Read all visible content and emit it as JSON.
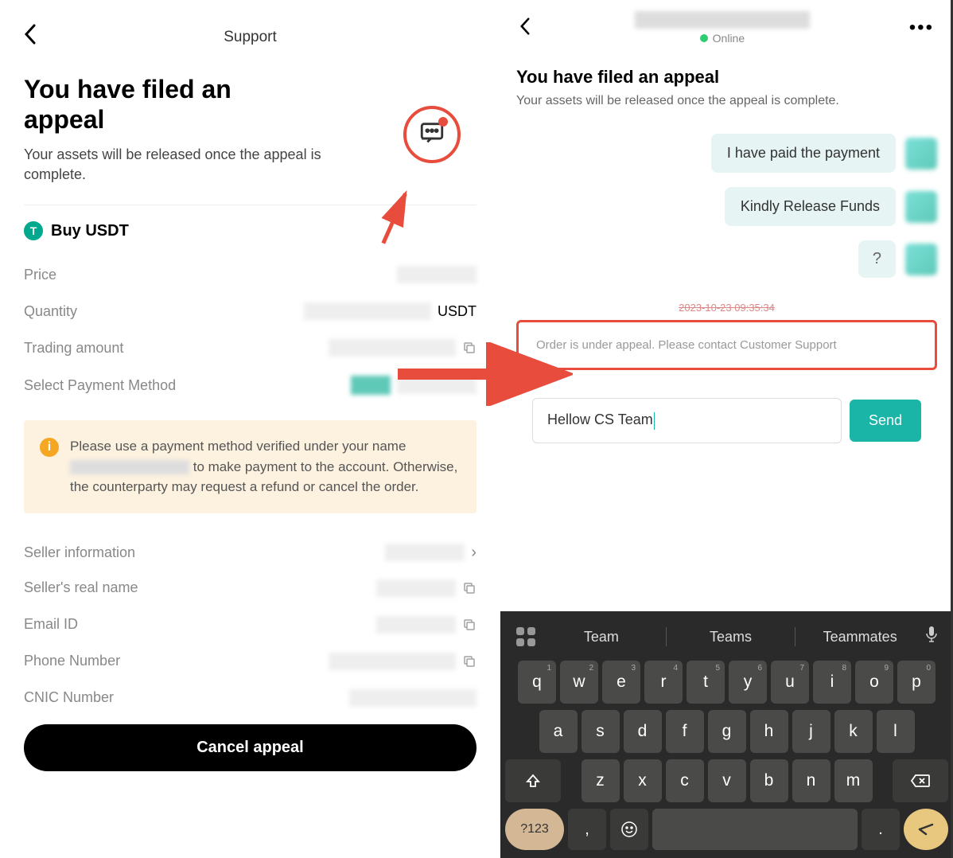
{
  "left": {
    "header": {
      "support": "Support"
    },
    "appeal": {
      "title": "You have filed an appeal",
      "subtitle": "Your assets will be released once the appeal is complete."
    },
    "token": {
      "symbol": "T",
      "label": "Buy USDT"
    },
    "rows": {
      "price": "Price",
      "quantity": "Quantity",
      "quantity_unit": "USDT",
      "trading_amount": "Trading amount",
      "payment_method": "Select Payment Method"
    },
    "notice": {
      "icon": "i",
      "text_before": "Please use a payment method verified under your name ",
      "text_after": " to make payment to the account. Otherwise, the counterparty may request a refund or cancel the order."
    },
    "seller": {
      "info": "Seller information",
      "real_name": "Seller's real name",
      "email": "Email ID",
      "phone": "Phone Number",
      "cnic": "CNIC Number"
    },
    "cancel_button": "Cancel appeal"
  },
  "right": {
    "status": "Online",
    "appeal": {
      "title": "You have filed an appeal",
      "subtitle": "Your assets will be released once the appeal is complete."
    },
    "messages": [
      "I have paid the payment",
      "Kindly Release Funds",
      "?"
    ],
    "system_timestamp": "2023-10-23 09:35:34",
    "system_message": "Order is under appeal. Please contact Customer Support",
    "input": {
      "value": "Hellow CS Team",
      "send": "Send"
    },
    "keyboard": {
      "suggestions": [
        "Team",
        "Teams",
        "Teammates"
      ],
      "row1": [
        {
          "k": "q",
          "n": "1"
        },
        {
          "k": "w",
          "n": "2"
        },
        {
          "k": "e",
          "n": "3"
        },
        {
          "k": "r",
          "n": "4"
        },
        {
          "k": "t",
          "n": "5"
        },
        {
          "k": "y",
          "n": "6"
        },
        {
          "k": "u",
          "n": "7"
        },
        {
          "k": "i",
          "n": "8"
        },
        {
          "k": "o",
          "n": "9"
        },
        {
          "k": "p",
          "n": "0"
        }
      ],
      "row2": [
        "a",
        "s",
        "d",
        "f",
        "g",
        "h",
        "j",
        "k",
        "l"
      ],
      "row3": [
        "z",
        "x",
        "c",
        "v",
        "b",
        "n",
        "m"
      ],
      "num_key": "?123",
      "comma": ",",
      "period": "."
    }
  }
}
